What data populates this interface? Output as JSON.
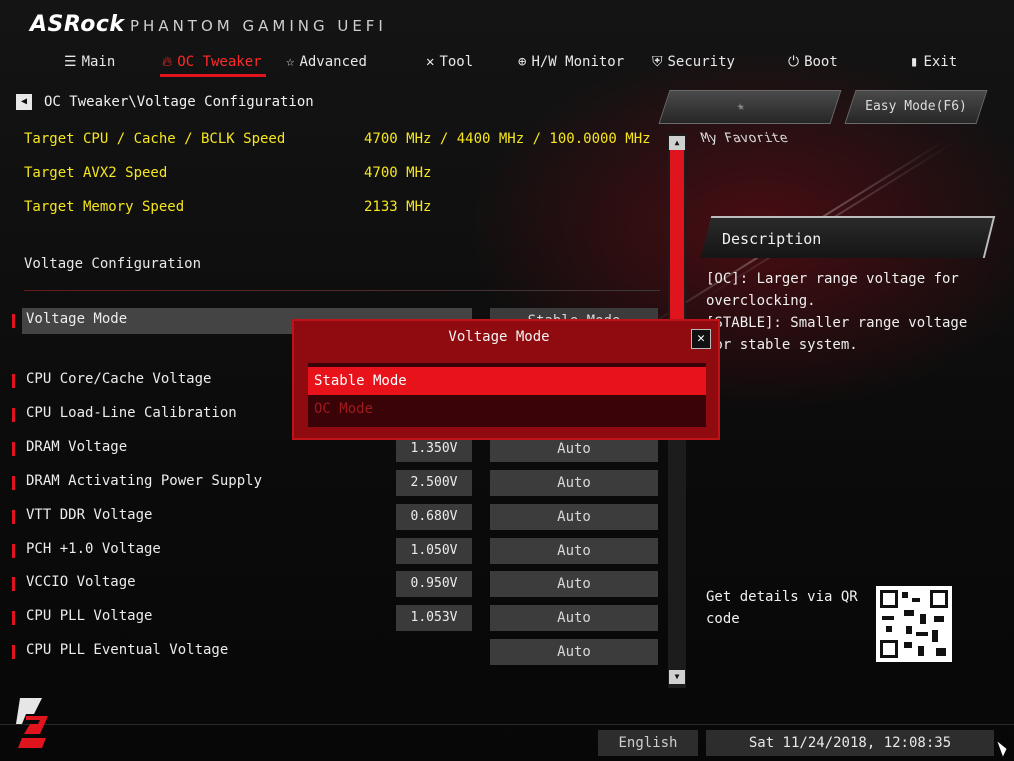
{
  "header": {
    "brand": "ASRock",
    "brand_sub": "PHANTOM GAMING UEFI"
  },
  "nav": {
    "items": [
      {
        "label": "Main",
        "icon": "list-icon"
      },
      {
        "label": "OC Tweaker",
        "icon": "flame-icon",
        "active": true
      },
      {
        "label": "Advanced",
        "icon": "star-icon"
      },
      {
        "label": "Tool",
        "icon": "tools-icon"
      },
      {
        "label": "H/W Monitor",
        "icon": "crosshair-icon"
      },
      {
        "label": "Security",
        "icon": "shield-icon"
      },
      {
        "label": "Boot",
        "icon": "power-icon"
      },
      {
        "label": "Exit",
        "icon": "exit-icon"
      }
    ]
  },
  "breadcrumb": "OC Tweaker\\Voltage Configuration",
  "favorites": {
    "my_favorite": "My Favorite",
    "easy_mode": "Easy Mode(F6)"
  },
  "info": [
    {
      "label": "Target CPU / Cache / BCLK Speed",
      "value": "4700 MHz / 4400 MHz / 100.0000 MHz"
    },
    {
      "label": "Target AVX2 Speed",
      "value": "4700 MHz"
    },
    {
      "label": "Target Memory Speed",
      "value": "2133 MHz"
    }
  ],
  "section_title": "Voltage Configuration",
  "settings": [
    {
      "label": "Voltage Mode",
      "value": "",
      "setting": "Stable Mode"
    },
    {
      "label": "CPU Core/Cache Voltage",
      "value": "",
      "setting": ""
    },
    {
      "label": "CPU Load-Line Calibration",
      "value": "",
      "setting": ""
    },
    {
      "label": "DRAM Voltage",
      "value": "1.350V",
      "setting": "Auto"
    },
    {
      "label": "DRAM Activating Power Supply",
      "value": "2.500V",
      "setting": "Auto"
    },
    {
      "label": "VTT DDR Voltage",
      "value": "0.680V",
      "setting": "Auto"
    },
    {
      "label": "PCH +1.0 Voltage",
      "value": "1.050V",
      "setting": "Auto"
    },
    {
      "label": "VCCIO Voltage",
      "value": "0.950V",
      "setting": "Auto"
    },
    {
      "label": "CPU PLL Voltage",
      "value": "1.053V",
      "setting": "Auto"
    },
    {
      "label": "CPU PLL Eventual Voltage",
      "value": "",
      "setting": "Auto"
    }
  ],
  "description": {
    "title": "Description",
    "text_oc": "[OC]: Larger range voltage for overclocking.",
    "text_stable": "[STABLE]: Smaller range voltage for stable system."
  },
  "qr": {
    "label": "Get details via QR code"
  },
  "popup": {
    "title": "Voltage Mode",
    "options": [
      "Stable Mode",
      "OC Mode"
    ],
    "selected": "Stable Mode"
  },
  "footer": {
    "language": "English",
    "datetime": "Sat 11/24/2018, 12:08:35"
  },
  "colors": {
    "accent": "#e0141c",
    "highlight": "#f5e61e"
  }
}
